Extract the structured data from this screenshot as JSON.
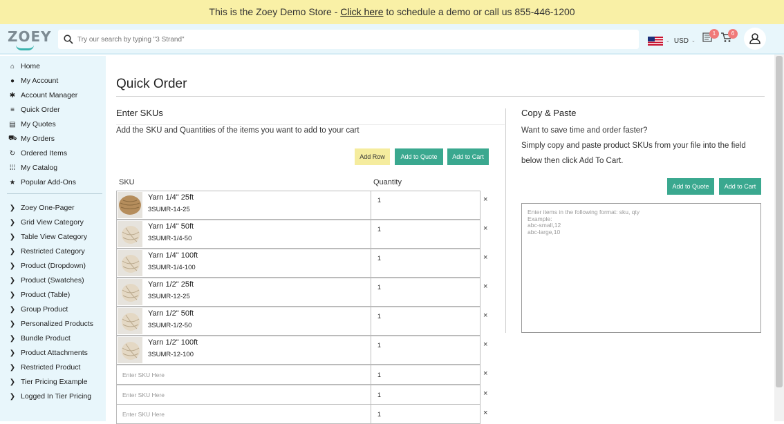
{
  "banner": {
    "prefix": "This is the Zoey Demo Store - ",
    "link": "Click here",
    "suffix": " to schedule a demo or call us 855-446-1200"
  },
  "header": {
    "logo": "ZOEY",
    "search_placeholder": "Try our search by typing \"3 Strand\"",
    "currency": "USD",
    "quote_badge": "1",
    "cart_badge": "6",
    "accent": "#3aa88f"
  },
  "sidebar": {
    "items": [
      {
        "label": "Home",
        "icon": "home-icon"
      },
      {
        "label": "My Account",
        "icon": "user-circle-icon"
      },
      {
        "label": "Account Manager",
        "icon": "gear-icon"
      },
      {
        "label": "Quick Order",
        "icon": "list-icon"
      },
      {
        "label": "My Quotes",
        "icon": "quote-icon"
      },
      {
        "label": "My Orders",
        "icon": "cart-icon"
      },
      {
        "label": "Ordered Items",
        "icon": "refresh-icon"
      },
      {
        "label": "My Catalog",
        "icon": "grid-icon"
      },
      {
        "label": "Popular Add-Ons",
        "icon": "star-icon"
      }
    ],
    "categories": [
      "Zoey One-Pager",
      "Grid View Category",
      "Table View Category",
      "Restricted Category",
      "Product (Dropdown)",
      "Product (Swatches)",
      "Product (Table)",
      "Group Product",
      "Personalized Products",
      "Bundle Product",
      "Product Attachments",
      "Restricted Product",
      "Tier Pricing Example",
      "Logged In Tier Pricing"
    ]
  },
  "page": {
    "title": "Quick Order",
    "enter_skus": {
      "heading": "Enter SKUs",
      "description": "Add the SKU and Quantities of the items you want to add to your cart",
      "add_row": "Add Row",
      "add_to_quote": "Add to Quote",
      "add_to_cart": "Add to Cart",
      "col_sku": "SKU",
      "col_qty": "Quantity",
      "rows": [
        {
          "name": "Yarn 1/4\" 25ft",
          "sku": "3SUMR-14-25",
          "qty": "1"
        },
        {
          "name": "Yarn 1/4\" 50ft",
          "sku": "3SUMR-1/4-50",
          "qty": "1"
        },
        {
          "name": "Yarn 1/4\" 100ft",
          "sku": "3SUMR-1/4-100",
          "qty": "1"
        },
        {
          "name": "Yarn 1/2\" 25ft",
          "sku": "3SUMR-12-25",
          "qty": "1"
        },
        {
          "name": "Yarn 1/2\" 50ft",
          "sku": "3SUMR-1/2-50",
          "qty": "1"
        },
        {
          "name": "Yarn 1/2\" 100ft",
          "sku": "3SUMR-12-100",
          "qty": "1"
        }
      ],
      "empty_rows": [
        {
          "placeholder": "Enter SKU Here",
          "qty": "1"
        },
        {
          "placeholder": "Enter SKU Here",
          "qty": "1"
        },
        {
          "placeholder": "Enter SKU Here",
          "qty": "1"
        }
      ],
      "remove": "×"
    },
    "copy_paste": {
      "heading": "Copy & Paste",
      "line1": "Want to save time and order faster?",
      "line2": "Simply copy and paste product SKUs from your file into the field",
      "line3": "below then click Add To Cart.",
      "add_to_quote": "Add to Quote",
      "add_to_cart": "Add to Cart",
      "placeholder": "Enter items in the following format: sku, qty\nExample:\nabc-small,12\nabc-large,10"
    }
  }
}
